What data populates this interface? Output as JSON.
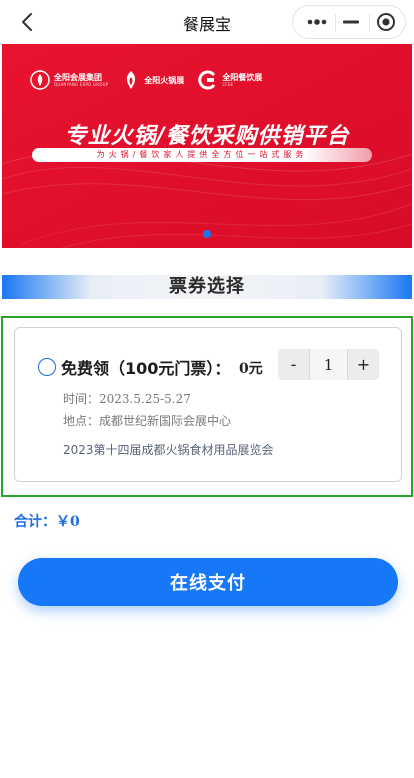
{
  "navbar": {
    "title": "餐展宝",
    "back_icon": "chevron-left-icon",
    "capsule_icons": [
      "more-dots-icon",
      "minimize-icon",
      "target-close-icon"
    ]
  },
  "banner": {
    "logos": [
      {
        "name": "全阳会展集团",
        "sub": "QUANYANG EXPO GROUP"
      },
      {
        "name": "全阳火锅展",
        "sub": ""
      },
      {
        "name": "全阳餐饮展",
        "sub": "CFEE"
      }
    ],
    "headline": "专业火锅/餐饮采购供销平台",
    "subline": "为火锅/餐饮家人提供全方位一站式服务",
    "active_slide": 1,
    "slide_count": 1,
    "colors": {
      "background": "#e3102b",
      "accent": "#ffffff"
    }
  },
  "section": {
    "title": "票券选择"
  },
  "ticket": {
    "selected": false,
    "name": "免费领（100元门票）：",
    "price": "0元",
    "quantity": "1",
    "minus_label": "-",
    "plus_label": "+",
    "time_label": "时间：",
    "time_value": "2023.5.25-5.27",
    "place_label": "地点：",
    "place_value": "成都世纪新国际会展中心",
    "expo_name": "2023第十四届成都火锅食材用品展览会"
  },
  "total": {
    "label": "合计：",
    "amount": "￥0"
  },
  "pay": {
    "label": "在线支付"
  },
  "colors": {
    "primary": "#1677f7",
    "highlight_border": "#26a626",
    "banner_red": "#e3102b"
  }
}
